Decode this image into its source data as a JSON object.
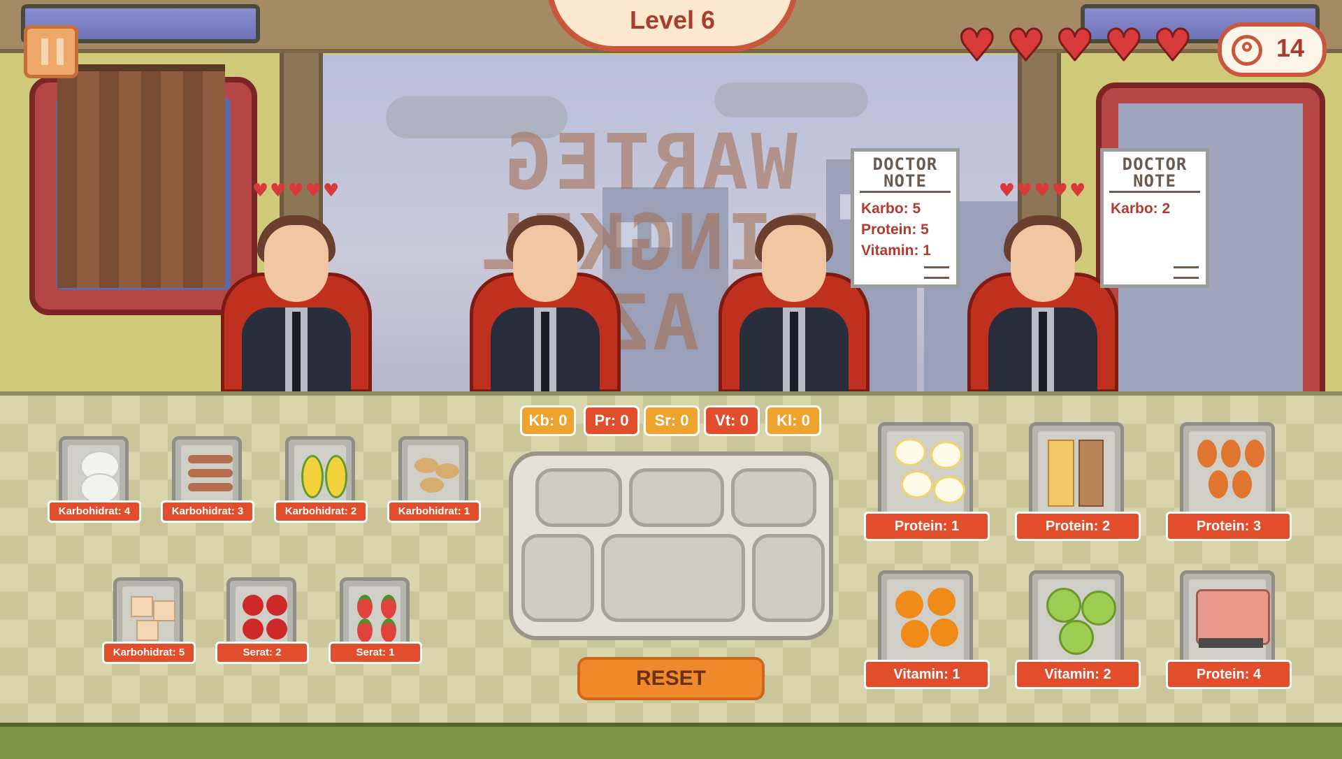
{
  "hud": {
    "level_text": "Level 6",
    "coin_count": "14",
    "lives": 5
  },
  "sign": {
    "line1": "WARTEG",
    "line2": "PINGKIL",
    "line3": "AZ"
  },
  "customers": [
    {
      "hearts": "♥♥♥♥♥"
    },
    {
      "hearts": ""
    },
    {
      "hearts": ""
    },
    {
      "hearts": "♥♥♥♥♥"
    }
  ],
  "doctor_notes": [
    {
      "title_1": "DOCTOR",
      "title_2": "NOTE",
      "lines": [
        "Karbo: 5",
        "Protein: 5",
        "Vitamin: 1"
      ]
    },
    {
      "title_1": "DOCTOR",
      "title_2": "NOTE",
      "lines": [
        "Karbo: 2"
      ]
    }
  ],
  "nutrient_counters": [
    {
      "label": "Kb: 0",
      "color": "#f0a22e"
    },
    {
      "label": "Pr: 0",
      "color": "#e24d2b"
    },
    {
      "label": "Sr: 0",
      "color": "#f0a22e"
    },
    {
      "label": "Vt: 0",
      "color": "#e24d2b"
    },
    {
      "label": "Kl: 0",
      "color": "#f0a22e"
    }
  ],
  "reset_label": "RESET",
  "foods_left": [
    {
      "label": "Karbohidrat: 4",
      "item": "rice-icon"
    },
    {
      "label": "Karbohidrat: 3",
      "item": "sausage-icon"
    },
    {
      "label": "Karbohidrat: 2",
      "item": "corn-icon"
    },
    {
      "label": "Karbohidrat: 1",
      "item": "potato-icon"
    },
    {
      "label": "Karbohidrat: 5",
      "item": "bread-icon"
    },
    {
      "label": "Serat: 2",
      "item": "apple-icon"
    },
    {
      "label": "Serat: 1",
      "item": "strawberry-icon"
    }
  ],
  "foods_right": [
    {
      "label": "Protein: 1",
      "item": "egg-icon"
    },
    {
      "label": "Protein: 2",
      "item": "tofu-tempeh-icon"
    },
    {
      "label": "Protein: 3",
      "item": "chicken-drumstick-icon"
    },
    {
      "label": "Vitamin: 1",
      "item": "orange-icon"
    },
    {
      "label": "Vitamin: 2",
      "item": "grapes-icon"
    },
    {
      "label": "Protein: 4",
      "item": "meat-icon"
    }
  ]
}
